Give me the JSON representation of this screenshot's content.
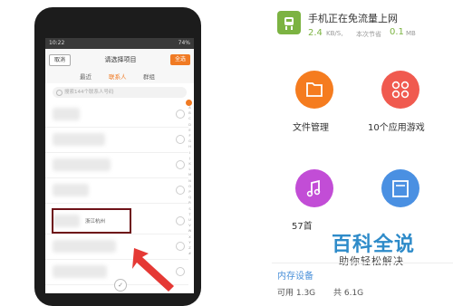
{
  "phone": {
    "status": {
      "time": "10:22",
      "battery": "74%"
    },
    "titlebar": {
      "cancel": "取消",
      "title": "请选择项目",
      "select_all": "全选"
    },
    "tabs": [
      {
        "label": "最近",
        "active": false
      },
      {
        "label": "联系人",
        "active": true
      },
      {
        "label": "群组",
        "active": false
      }
    ],
    "search_placeholder": "搜索144个联系人号码",
    "rows": [
      {
        "text": ""
      },
      {
        "text": ""
      },
      {
        "text": ""
      },
      {
        "text": ""
      },
      {
        "text": "浙江杭州"
      },
      {
        "text": ""
      }
    ],
    "index_letters": [
      "A",
      "B",
      "C",
      "D",
      "E",
      "F",
      "G",
      "H",
      "I",
      "J",
      "K",
      "L",
      "M",
      "N",
      "O",
      "P",
      "Q",
      "R",
      "S",
      "T",
      "U",
      "V",
      "W",
      "X",
      "Y",
      "Z",
      "#"
    ],
    "highlight_color": "#6e1218",
    "accent": "#f07a23"
  },
  "network": {
    "title": "手机正在免流量上网",
    "speed": "2.4",
    "speed_unit": "KB/S,",
    "saved_label": "本次节省",
    "saved_value": "0.1",
    "saved_unit": "MB"
  },
  "cards": [
    {
      "label": "文件管理",
      "icon": "folder-icon",
      "color": "#f57c1f"
    },
    {
      "label": "10个应用游戏",
      "icon": "apps-icon",
      "color": "#f05a4f"
    },
    {
      "label": "57首",
      "icon": "music-icon",
      "color": "#c24dd6"
    },
    {
      "label": "",
      "icon": "document-icon",
      "color": "#4a90e2"
    }
  ],
  "storage": {
    "title": "内存设备",
    "available": "可用 1.3G",
    "total": "共 6.1G"
  },
  "watermark": {
    "logo": "百科全说",
    "sub": "助你轻松解决"
  }
}
